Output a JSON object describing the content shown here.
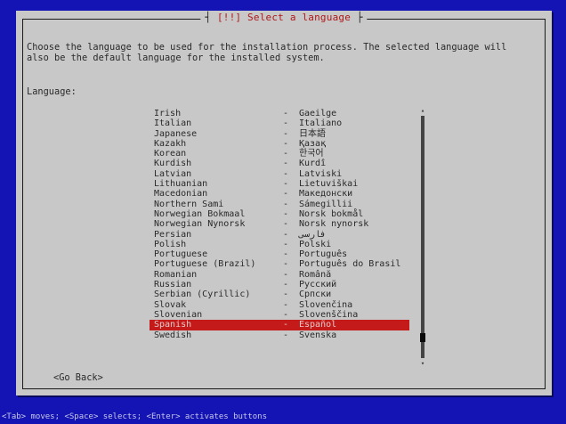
{
  "dialog": {
    "title_open": "┤",
    "title_text": "[!!] Select a language",
    "title_close": "├",
    "description": "Choose the language to be used for the installation process. The selected language will\nalso be the default language for the installed system.",
    "language_label": "Language:",
    "go_back_label": "<Go Back>"
  },
  "languages": [
    {
      "name": "Irish",
      "dash": "-",
      "native": "Gaeilge"
    },
    {
      "name": "Italian",
      "dash": "-",
      "native": "Italiano"
    },
    {
      "name": "Japanese",
      "dash": "-",
      "native": "日本語"
    },
    {
      "name": "Kazakh",
      "dash": "-",
      "native": "Қазақ"
    },
    {
      "name": "Korean",
      "dash": "-",
      "native": "한국어"
    },
    {
      "name": "Kurdish",
      "dash": "-",
      "native": "Kurdî"
    },
    {
      "name": "Latvian",
      "dash": "-",
      "native": "Latviski"
    },
    {
      "name": "Lithuanian",
      "dash": "-",
      "native": "Lietuviškai"
    },
    {
      "name": "Macedonian",
      "dash": "-",
      "native": "Македонски"
    },
    {
      "name": "Northern Sami",
      "dash": "-",
      "native": "Sámegillii"
    },
    {
      "name": "Norwegian Bokmaal",
      "dash": "-",
      "native": "Norsk bokmål"
    },
    {
      "name": "Norwegian Nynorsk",
      "dash": "-",
      "native": "Norsk nynorsk"
    },
    {
      "name": "Persian",
      "dash": "-",
      "native": "فارسی"
    },
    {
      "name": "Polish",
      "dash": "-",
      "native": "Polski"
    },
    {
      "name": "Portuguese",
      "dash": "-",
      "native": "Português"
    },
    {
      "name": "Portuguese (Brazil)",
      "dash": "-",
      "native": "Português do Brasil"
    },
    {
      "name": "Romanian",
      "dash": "-",
      "native": "Română"
    },
    {
      "name": "Russian",
      "dash": "-",
      "native": "Русский"
    },
    {
      "name": "Serbian (Cyrillic)",
      "dash": "-",
      "native": "Српски"
    },
    {
      "name": "Slovak",
      "dash": "-",
      "native": "Slovenčina"
    },
    {
      "name": "Slovenian",
      "dash": "-",
      "native": "Slovenščina"
    },
    {
      "name": "Spanish",
      "dash": "-",
      "native": "Español"
    },
    {
      "name": "Swedish",
      "dash": "-",
      "native": "Svenska"
    }
  ],
  "selected_language": "Spanish",
  "scrollbar": {
    "up_arrow": "▴",
    "down_arrow": "▾",
    "position_fraction": 0.93
  },
  "status_bar": "<Tab> moves; <Space> selects; <Enter> activates buttons",
  "colors": {
    "screen_bg": "#1414b4",
    "dialog_bg": "#c8c8c8",
    "title_text": "#b01818",
    "selected_bg": "#c41a1a"
  }
}
